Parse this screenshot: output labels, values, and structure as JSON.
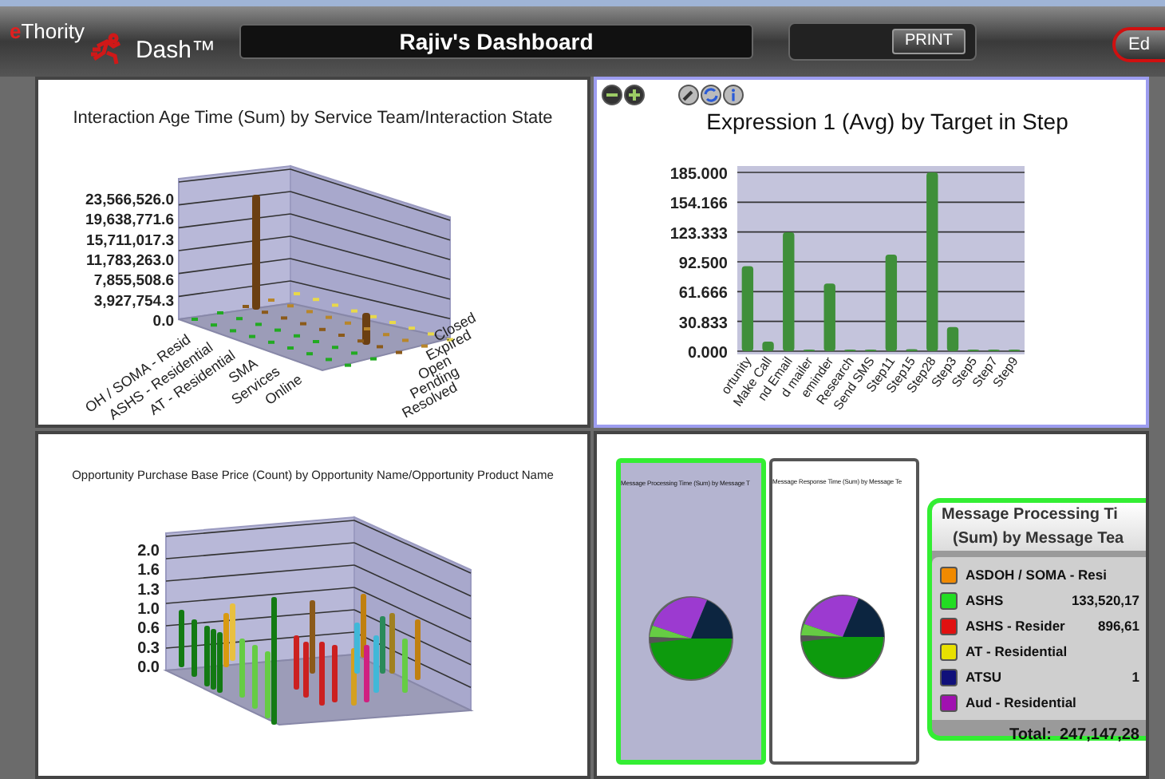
{
  "header": {
    "logo": {
      "initial": "e",
      "name": "Thority",
      "product": "Dash™"
    },
    "title": "Rajiv's Dashboard",
    "print_button": "PRINT",
    "edit_button": "Ed"
  },
  "panels": [
    {
      "kind": "chart3d",
      "selected": false,
      "title": "Interaction Age Time (Sum) by Service Team/Interaction State",
      "yticks": [
        "23,566,526.0",
        "19,638,771.6",
        "15,711,017.3",
        "11,783,263.0",
        "7,855,508.6",
        "3,927,754.3",
        "0.0"
      ],
      "x_labels": [
        "OH / SOMA - Resid",
        "ASHS - Residential",
        "AT - Residential",
        "SMA",
        "Services",
        "Online"
      ],
      "z_labels": [
        "Closed",
        "Expired",
        "Open",
        "Pending",
        "Resolved"
      ]
    },
    {
      "kind": "bar",
      "selected": true,
      "chart_data": {
        "type": "bar",
        "title": "Expression 1 (Avg) by Target in Step",
        "categories": [
          "ortunity",
          "Make Call",
          "nd Email",
          "d mailer",
          "eminder",
          "Research",
          "Send SMS",
          "Step11",
          "Step15",
          "Step28",
          "Step3",
          "Step5",
          "Step7",
          "Step9"
        ],
        "series": [
          {
            "color": "#3f8f3a",
            "values": [
              88,
              10,
              123,
              0,
              70,
              0,
              0,
              100,
              2,
              185,
              25,
              0,
              0,
              0
            ]
          }
        ],
        "ylim": [
          0,
          185
        ],
        "grid": true,
        "yticks": [
          {
            "value": 0,
            "label": "0.000"
          },
          {
            "value": 30.833,
            "label": "30.833"
          },
          {
            "value": 61.666,
            "label": "61.666"
          },
          {
            "value": 92.5,
            "label": "92.500"
          },
          {
            "value": 123.333,
            "label": "123.333"
          },
          {
            "value": 154.166,
            "label": "154.166"
          },
          {
            "value": 185,
            "label": "185.000"
          }
        ]
      }
    },
    {
      "kind": "chart3d_multi",
      "selected": false,
      "title": "Opportunity Purchase Base Price (Count) by Opportunity Name/Opportunity Product Name",
      "yticks": [
        "2.0",
        "1.6",
        "1.3",
        "1.0",
        "0.6",
        "0.3",
        "0.0"
      ]
    },
    {
      "kind": "pies",
      "selected": false,
      "pies": [
        {
          "title": "Message Processing Time (Sum) by Message T",
          "selected": true
        },
        {
          "title": "Message Response Time (Sum) by Message Te",
          "selected": false
        }
      ],
      "legend": {
        "title": [
          "Message Processing Ti",
          "(Sum) by Message Tea"
        ],
        "items": [
          {
            "label": "ASDOH / SOMA - Resi",
            "value": "",
            "color": "#f08a00"
          },
          {
            "label": "ASHS",
            "value": "133,520,17",
            "color": "#22dd22"
          },
          {
            "label": "ASHS - Resider",
            "value": "896,61",
            "color": "#e01010"
          },
          {
            "label": "AT - Residential",
            "value": "",
            "color": "#e8e000"
          },
          {
            "label": "ATSU",
            "value": "1",
            "color": "#10107a"
          },
          {
            "label": "Aud - Residential",
            "value": "",
            "color": "#a010b0"
          }
        ],
        "total_label": "Total:",
        "total_value": "247,147,28"
      }
    }
  ]
}
